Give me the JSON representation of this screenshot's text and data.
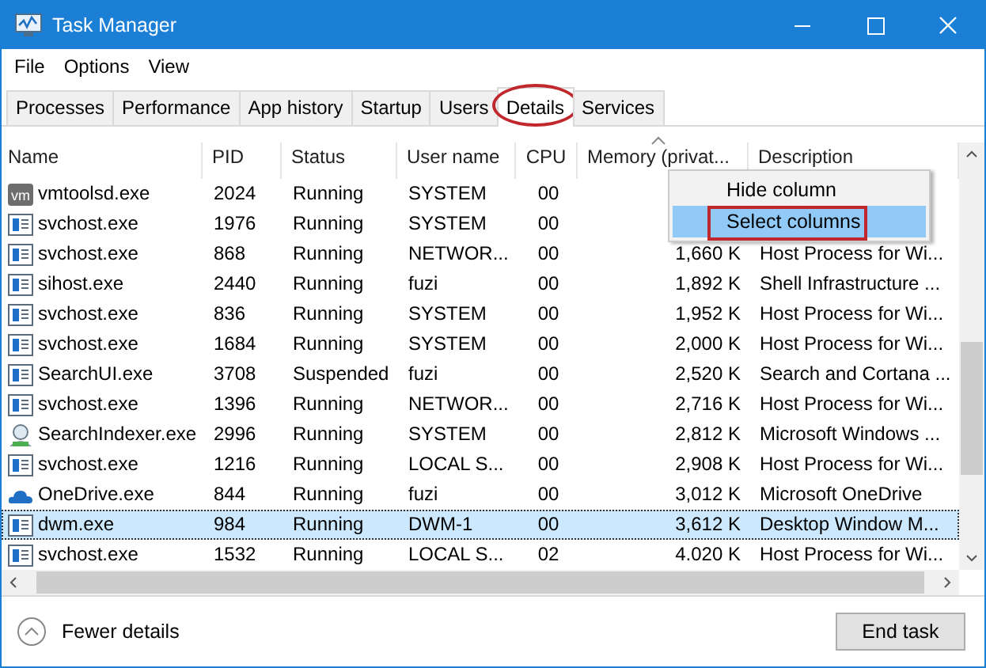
{
  "window": {
    "title": "Task Manager"
  },
  "menu": [
    "File",
    "Options",
    "View"
  ],
  "tabs": [
    {
      "label": "Processes",
      "selected": false
    },
    {
      "label": "Performance",
      "selected": false
    },
    {
      "label": "App history",
      "selected": false
    },
    {
      "label": "Startup",
      "selected": false
    },
    {
      "label": "Users",
      "selected": false
    },
    {
      "label": "Details",
      "selected": true
    },
    {
      "label": "Services",
      "selected": false
    }
  ],
  "table": {
    "columns": [
      {
        "label": "Name",
        "sorted": false
      },
      {
        "label": "PID",
        "sorted": false
      },
      {
        "label": "Status",
        "sorted": false
      },
      {
        "label": "User name",
        "sorted": false
      },
      {
        "label": "CPU",
        "sorted": false
      },
      {
        "label": "Memory (privat...",
        "sorted": true
      },
      {
        "label": "Description",
        "sorted": false
      }
    ],
    "rows": [
      {
        "kind": "vm",
        "name": "vmtoolsd.exe",
        "pid": "2024",
        "status": "Running",
        "user": "SYSTEM",
        "cpu": "00",
        "selected": false
      },
      {
        "kind": "service",
        "name": "svchost.exe",
        "pid": "1976",
        "status": "Running",
        "user": "SYSTEM",
        "cpu": "00",
        "selected": false
      },
      {
        "kind": "service",
        "name": "svchost.exe",
        "pid": "868",
        "status": "Running",
        "user": "NETWOR...",
        "cpu": "00",
        "memory": "1,660 K",
        "description": "Host Process for Wi...",
        "selected": false
      },
      {
        "kind": "service",
        "name": "sihost.exe",
        "pid": "2440",
        "status": "Running",
        "user": "fuzi",
        "cpu": "00",
        "memory": "1,892 K",
        "description": "Shell Infrastructure ...",
        "selected": false
      },
      {
        "kind": "service",
        "name": "svchost.exe",
        "pid": "836",
        "status": "Running",
        "user": "SYSTEM",
        "cpu": "00",
        "memory": "1,952 K",
        "description": "Host Process for Wi...",
        "selected": false
      },
      {
        "kind": "service",
        "name": "svchost.exe",
        "pid": "1684",
        "status": "Running",
        "user": "SYSTEM",
        "cpu": "00",
        "memory": "2,000 K",
        "description": "Host Process for Wi...",
        "selected": false
      },
      {
        "kind": "service",
        "name": "SearchUI.exe",
        "pid": "3708",
        "status": "Suspended",
        "user": "fuzi",
        "cpu": "00",
        "memory": "2,520 K",
        "description": "Search and Cortana ...",
        "selected": false
      },
      {
        "kind": "service",
        "name": "svchost.exe",
        "pid": "1396",
        "status": "Running",
        "user": "NETWOR...",
        "cpu": "00",
        "memory": "2,716 K",
        "description": "Host Process for Wi...",
        "selected": false
      },
      {
        "kind": "indexer",
        "name": "SearchIndexer.exe",
        "pid": "2996",
        "status": "Running",
        "user": "SYSTEM",
        "cpu": "00",
        "memory": "2,812 K",
        "description": "Microsoft Windows ...",
        "selected": false
      },
      {
        "kind": "service",
        "name": "svchost.exe",
        "pid": "1216",
        "status": "Running",
        "user": "LOCAL S...",
        "cpu": "00",
        "memory": "2,908 K",
        "description": "Host Process for Wi...",
        "selected": false
      },
      {
        "kind": "cloud",
        "name": "OneDrive.exe",
        "pid": "844",
        "status": "Running",
        "user": "fuzi",
        "cpu": "00",
        "memory": "3,012 K",
        "description": "Microsoft OneDrive",
        "selected": false
      },
      {
        "kind": "service",
        "name": "dwm.exe",
        "pid": "984",
        "status": "Running",
        "user": "DWM-1",
        "cpu": "00",
        "memory": "3,612 K",
        "description": "Desktop Window M...",
        "selected": true
      },
      {
        "kind": "service",
        "name": "svchost.exe",
        "pid": "1532",
        "status": "Running",
        "user": "LOCAL S...",
        "cpu": "02",
        "memory": "4.020 K",
        "description": "Host Process for Wi...",
        "selected": false
      }
    ]
  },
  "context_menu": [
    {
      "label": "Hide column",
      "selected": false
    },
    {
      "label": "Select columns",
      "selected": true
    }
  ],
  "footer": {
    "toggle": "Fewer details",
    "button": "End task"
  }
}
